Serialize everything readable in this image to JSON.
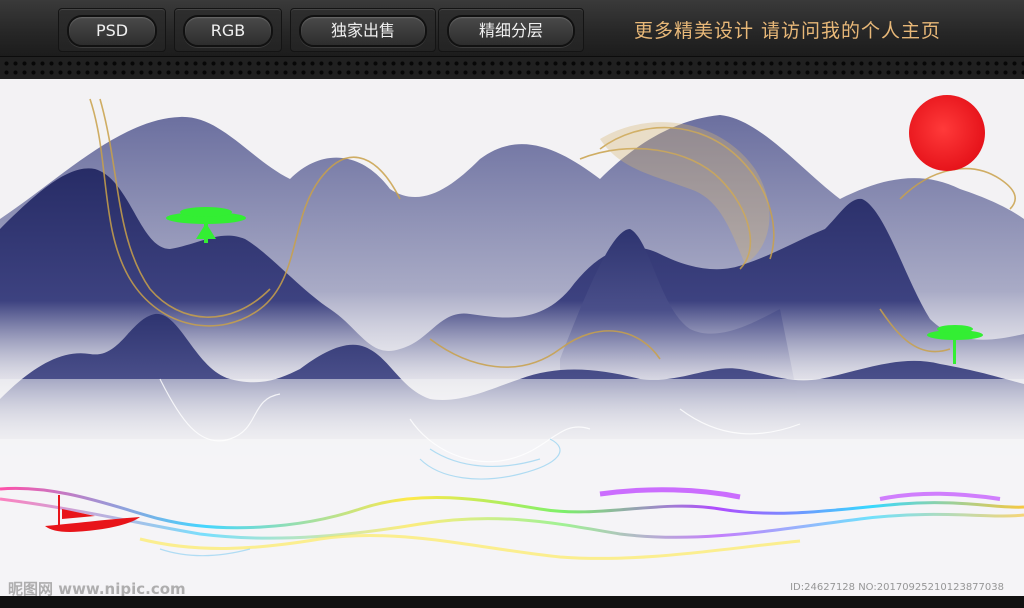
{
  "toolbar": {
    "tabs": [
      {
        "label": "PSD"
      },
      {
        "label": "RGB"
      },
      {
        "label": "独家出售"
      },
      {
        "label": "精细分层"
      }
    ],
    "promo": "更多精美设计  请访问我的个人主页"
  },
  "watermark": {
    "logo": "昵图网 www.nipic.com",
    "id": "ID:24627128 NO:20170925210123877038"
  },
  "colors": {
    "mountain": "#2e3470",
    "gold": "#c9a14a",
    "sun": "#ee1c24",
    "tree": "#33ee33",
    "boat": "#e8141a"
  }
}
